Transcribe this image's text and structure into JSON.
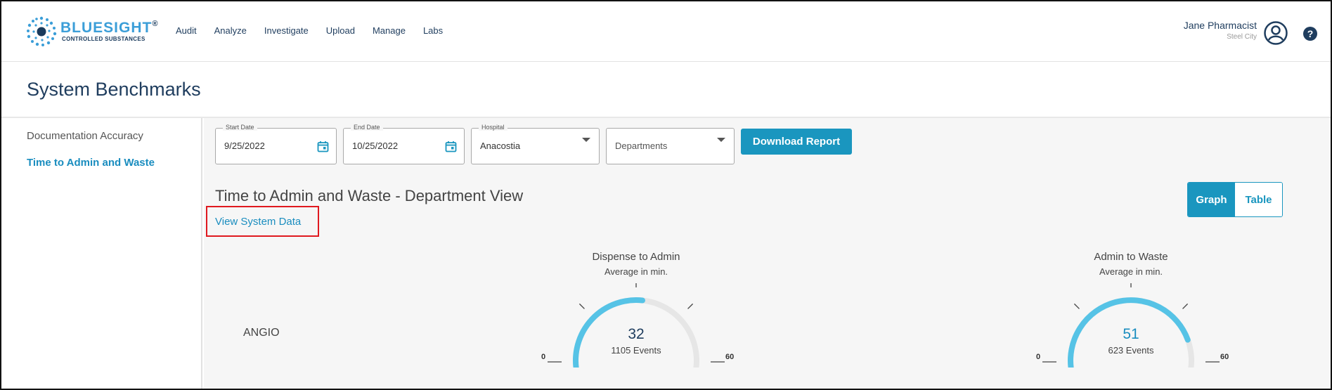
{
  "header": {
    "logo_title": "BLUESIGHT",
    "logo_registered": "®",
    "logo_subtitle": "CONTROLLED SUBSTANCES",
    "nav": [
      "Audit",
      "Analyze",
      "Investigate",
      "Upload",
      "Manage",
      "Labs"
    ],
    "user_name": "Jane Pharmacist",
    "user_location": "Steel City",
    "avatar_icon": "user-circle-icon",
    "help_icon": "question-circle-icon"
  },
  "page": {
    "title": "System Benchmarks"
  },
  "sidebar": {
    "items": [
      {
        "label": "Documentation Accuracy",
        "active": false
      },
      {
        "label": "Time to Admin and Waste",
        "active": true
      }
    ]
  },
  "filters": {
    "start_date": {
      "label": "Start Date",
      "value": "9/25/2022"
    },
    "end_date": {
      "label": "End Date",
      "value": "10/25/2022"
    },
    "hospital": {
      "label": "Hospital",
      "value": "Anacostia"
    },
    "departments": {
      "placeholder": "Departments"
    },
    "download_label": "Download Report"
  },
  "section": {
    "title": "Time to Admin and Waste - Department View",
    "system_link": "View System Data",
    "toggle": {
      "graph": "Graph",
      "table": "Table",
      "selected": "Graph"
    }
  },
  "rows": [
    {
      "department": "ANGIO",
      "gauges": [
        {
          "title": "Dispense to Admin",
          "subtitle": "Average in min.",
          "value": "32",
          "events": "1105 Events",
          "min": "0",
          "max": "60",
          "fill_fraction": 0.53,
          "value_color": "#1f3d5e"
        },
        {
          "title": "Admin to Waste",
          "subtitle": "Average in min.",
          "value": "51",
          "events": "623 Events",
          "min": "0",
          "max": "60",
          "fill_fraction": 0.85,
          "value_color": "#1a8dbf"
        }
      ]
    }
  ],
  "colors": {
    "accent": "#1a96bf",
    "gauge_fill": "#56c3e6",
    "gauge_track": "#e6e6e6",
    "highlight": "#e0191f"
  }
}
